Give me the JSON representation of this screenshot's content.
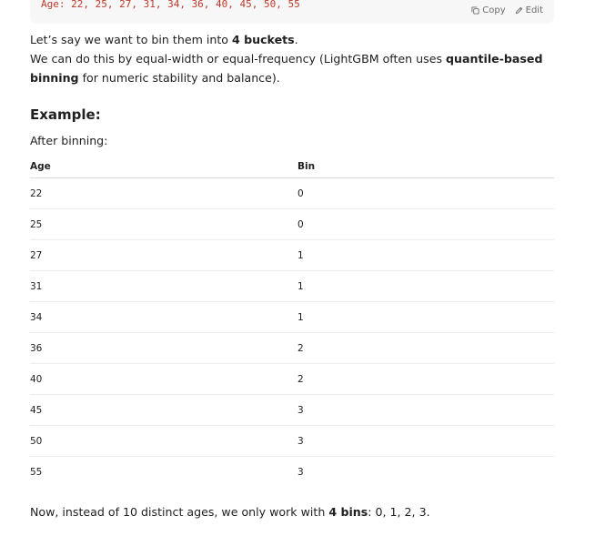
{
  "code": {
    "line": "Age: 22, 25, 27, 31, 34, 36, 40, 45, 50, 55",
    "copy_label": "Copy",
    "edit_label": "Edit"
  },
  "intro": {
    "prefix": "Let’s say we want to bin them into ",
    "bold": "4 buckets",
    "suffix": "."
  },
  "method": {
    "prefix": "We can do this by equal-width or equal-frequency (LightGBM often uses ",
    "bold": "quantile-based binning",
    "suffix": " for numeric stability and balance)."
  },
  "example_heading": "Example:",
  "after_binning": "After binning:",
  "table": {
    "headers": [
      "Age",
      "Bin"
    ],
    "rows": [
      [
        "22",
        "0"
      ],
      [
        "25",
        "0"
      ],
      [
        "27",
        "1"
      ],
      [
        "31",
        "1"
      ],
      [
        "34",
        "1"
      ],
      [
        "36",
        "2"
      ],
      [
        "40",
        "2"
      ],
      [
        "45",
        "3"
      ],
      [
        "50",
        "3"
      ],
      [
        "55",
        "3"
      ]
    ]
  },
  "summary": {
    "prefix": "Now, instead of 10 distinct ages, we only work with ",
    "bold": "4 bins",
    "suffix": ": 0, 1, 2, 3."
  }
}
